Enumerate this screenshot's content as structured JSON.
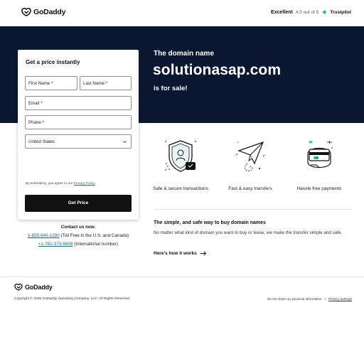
{
  "header": {
    "logo_text": "GoDaddy",
    "trust_excellent": "Excellent",
    "trust_rating": "4.5 out of 5",
    "trust_brand": "Trustpilot"
  },
  "hero": {
    "subtitle": "The domain name",
    "domain": "solutionasap.com",
    "sale_text": "is for sale!"
  },
  "form": {
    "title": "Get a price instantly",
    "first_name": "First Name *",
    "last_name": "Last Name *",
    "email": "Email *",
    "phone": "Phone *",
    "country": "United States",
    "disclaimer": "By submitting, you agree to our",
    "privacy_link": "Privacy Policy",
    "submit_label": "Get Price"
  },
  "contact": {
    "title": "Contact us now.",
    "phone1": "1-855-646-1390",
    "phone1_note": "(Toll Free in the U.S. and Canada)",
    "phone2": "+1-781-373-6808",
    "phone2_note": "(International number)"
  },
  "features": [
    {
      "label": "Safe & secure transactions",
      "icon": "shield-icon"
    },
    {
      "label": "Fast & easy transfers",
      "icon": "paper-plane-icon"
    },
    {
      "label": "Hassle free payments",
      "icon": "payment-card-icon"
    }
  ],
  "info": {
    "title": "The simple, and safe way to buy domain names",
    "text": "No matter what kind of domain you want to buy or lease, we make the transfer simple and safe.",
    "link": "Here's how it works"
  },
  "footer": {
    "logo_text": "GoDaddy",
    "copyright": "Copyright © 2026 GoDaddy Operating Company, LLC. All Rights Reserved.",
    "do_not_share": "Do not share my personal information",
    "separator": "•",
    "privacy_settings": "Privacy Settings"
  },
  "colors": {
    "hero_bg": "#0b1730",
    "accent_teal": "#1a6f74",
    "trustpilot_green": "#00b67a",
    "button_bg": "#111111"
  }
}
